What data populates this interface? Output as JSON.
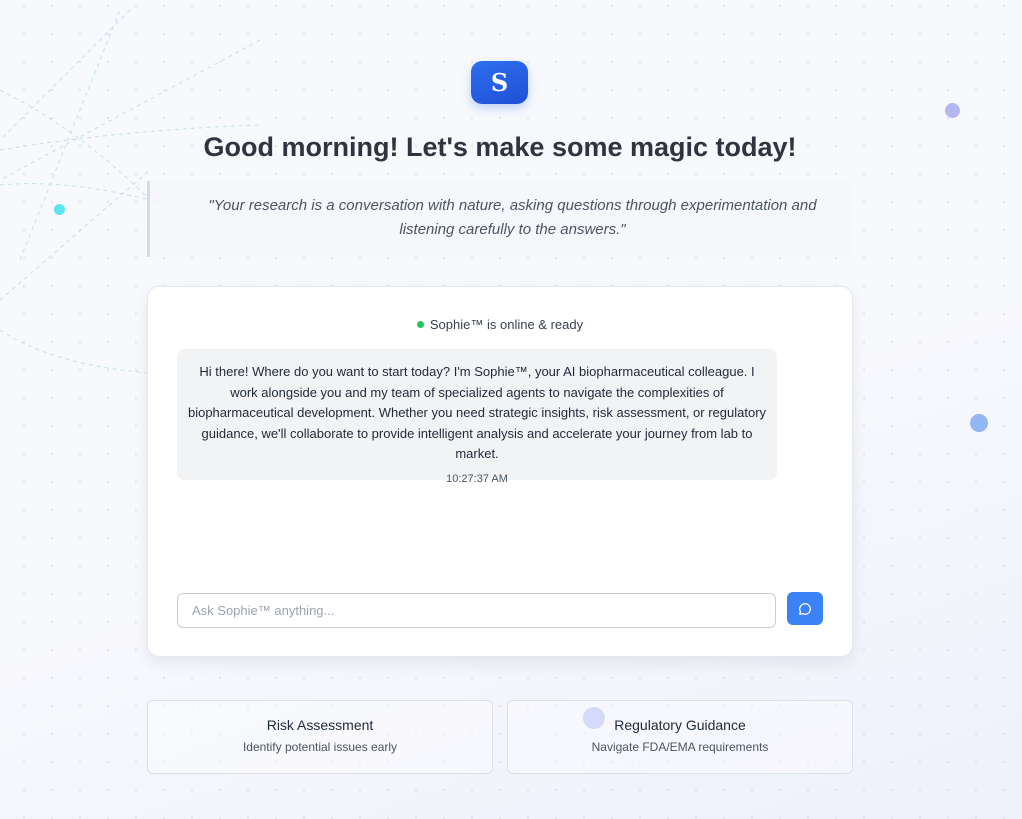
{
  "brand": {
    "logo_letter": "S"
  },
  "greeting": "Good morning! Let's make some magic today!",
  "quote": "\"Your research is a conversation with nature, asking questions through experimentation and listening carefully to the answers.\"",
  "chat": {
    "status_text": "Sophie™ is online & ready",
    "message": {
      "text": "Hi there! Where do you want to start today? I'm Sophie™, your AI biopharmaceutical colleague. I work alongside you and my team of specialized agents to navigate the complexities of biopharmaceutical development. Whether you need strategic insights, risk assessment, or regulatory guidance, we'll collaborate to provide intelligent analysis and accelerate your journey from lab to market.",
      "time": "10:27:37 AM"
    },
    "input": {
      "placeholder": "Ask Sophie™ anything...",
      "value": ""
    },
    "send_icon": "chat-bubble-icon"
  },
  "cards": [
    {
      "title": "Risk Assessment",
      "subtitle": "Identify potential issues early"
    },
    {
      "title": "Regulatory Guidance",
      "subtitle": "Navigate FDA/EMA requirements"
    }
  ],
  "colors": {
    "accent": "#2563eb",
    "send_button": "#3b82f6",
    "status_online": "#22c55e",
    "bubble_bg": "#f2f3f5"
  }
}
